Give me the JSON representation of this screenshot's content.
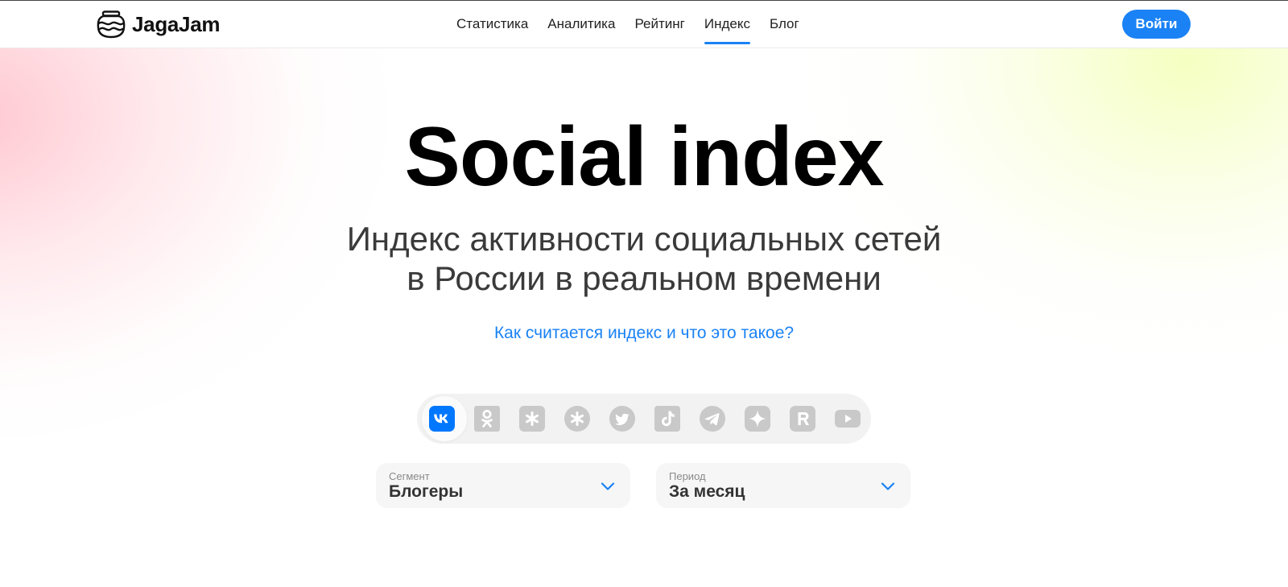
{
  "header": {
    "logo_text": "JagaJam",
    "nav": [
      {
        "label": "Статистика",
        "active": false
      },
      {
        "label": "Аналитика",
        "active": false
      },
      {
        "label": "Рейтинг",
        "active": false
      },
      {
        "label": "Индекс",
        "active": true
      },
      {
        "label": "Блог",
        "active": false
      }
    ],
    "login_label": "Войти"
  },
  "hero": {
    "title": "Social index",
    "subtitle_line1": "Индекс активности социальных сетей",
    "subtitle_line2": "в России в реальном времени",
    "link": "Как считается индекс и что это такое?"
  },
  "networks": {
    "selected": "vk",
    "items": [
      {
        "id": "vk",
        "icon": "vk-icon"
      },
      {
        "id": "odnoklassniki",
        "icon": "odnoklassniki-icon"
      },
      {
        "id": "mail-ru",
        "icon": "mail-ru-square-icon"
      },
      {
        "id": "moi-mir",
        "icon": "mail-ru-circle-icon"
      },
      {
        "id": "twitter",
        "icon": "twitter-icon"
      },
      {
        "id": "tiktok",
        "icon": "tiktok-icon"
      },
      {
        "id": "telegram",
        "icon": "telegram-icon"
      },
      {
        "id": "dzen",
        "icon": "dzen-icon"
      },
      {
        "id": "rutube",
        "icon": "rutube-icon"
      },
      {
        "id": "youtube",
        "icon": "youtube-icon"
      }
    ]
  },
  "filters": {
    "segment": {
      "label": "Сегмент",
      "value": "Блогеры"
    },
    "period": {
      "label": "Период",
      "value": "За месяц"
    }
  },
  "colors": {
    "accent": "#1a82f5",
    "icon_inactive": "#c9c9c9",
    "text": "#222222"
  }
}
